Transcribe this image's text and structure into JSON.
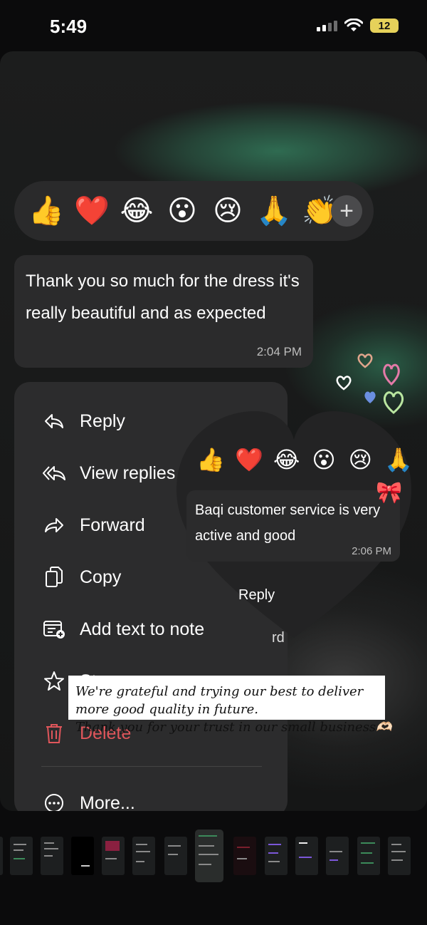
{
  "status_bar": {
    "time": "5:49",
    "battery": "12"
  },
  "reactions": {
    "emojis": [
      "👍",
      "❤️",
      "😂",
      "😮",
      "😢",
      "🙏",
      "👏"
    ],
    "add_label": "+"
  },
  "message": {
    "text": "Thank you so much for the dress it's really beautiful and as expected",
    "time": "2:04 PM"
  },
  "context_menu": {
    "items": [
      {
        "label": "Reply",
        "icon": "reply-icon"
      },
      {
        "label": "View replies",
        "icon": "view-replies-icon"
      },
      {
        "label": "Forward",
        "icon": "forward-icon"
      },
      {
        "label": "Copy",
        "icon": "copy-icon"
      },
      {
        "label": "Add text to note",
        "icon": "add-note-icon"
      },
      {
        "label": "Star",
        "icon": "star-icon"
      },
      {
        "label": "Delete",
        "icon": "trash-icon"
      },
      {
        "label": "More...",
        "icon": "more-icon"
      }
    ]
  },
  "heart_overlay": {
    "emojis": [
      "👍",
      "❤️",
      "😂",
      "😮",
      "😢",
      "🙏"
    ],
    "message": "Baqi customer service is very active and good",
    "time": "2:06 PM",
    "reply_label": "Reply",
    "partial_label": "rd"
  },
  "caption": {
    "lines": [
      "We're grateful and trying our best to deliver",
      "more good quality in future.",
      "Thank you for your trust in our small business🫶🏻"
    ]
  },
  "colors": {
    "accent_green": "#2f6b51",
    "battery_yellow": "#e6d15a",
    "delete_red": "#e0565b",
    "menu_bg": "#2c2c2d",
    "bubble_bg": "#2b2b2c"
  }
}
